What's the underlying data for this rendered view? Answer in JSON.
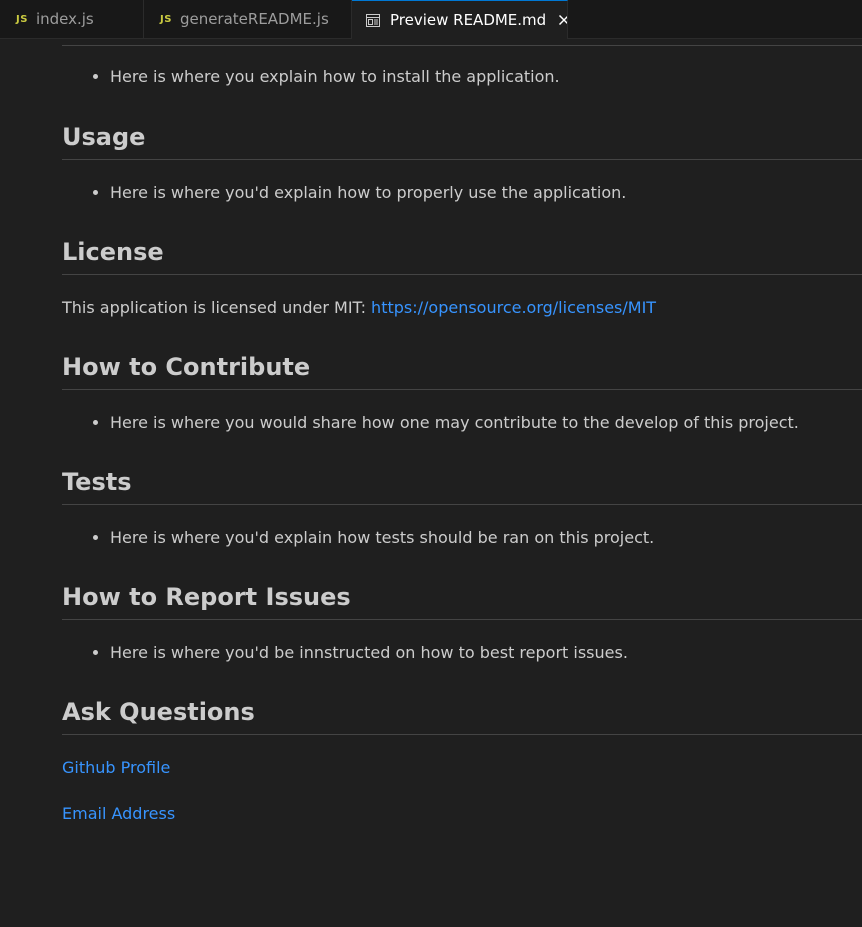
{
  "tabs": [
    {
      "icon": "JS",
      "label": "index.js",
      "active": false
    },
    {
      "icon": "JS",
      "label": "generateREADME.js",
      "active": false
    },
    {
      "icon": "preview-icon",
      "label": "Preview README.md",
      "active": true
    }
  ],
  "installation": {
    "bullet": "Here is where you explain how to install the application."
  },
  "usage": {
    "heading": "Usage",
    "bullet": "Here is where you'd explain how to properly use the application."
  },
  "license": {
    "heading": "License",
    "text": "This application is licensed under MIT: ",
    "link": "https://opensource.org/licenses/MIT"
  },
  "contribute": {
    "heading": "How to Contribute",
    "bullet": "Here is where you would share how one may contribute to the develop of this project."
  },
  "tests": {
    "heading": "Tests",
    "bullet": "Here is where you'd explain how tests should be ran on this project."
  },
  "issues": {
    "heading": "How to Report Issues",
    "bullet": "Here is where you'd be innstructed on how to best report issues."
  },
  "questions": {
    "heading": "Ask Questions",
    "github_link": "Github Profile",
    "email_link": "Email Address"
  },
  "colors": {
    "background": "#1f1f1f",
    "tabbar": "#181818",
    "link": "#3794ff",
    "js_icon": "#cbcb41"
  }
}
